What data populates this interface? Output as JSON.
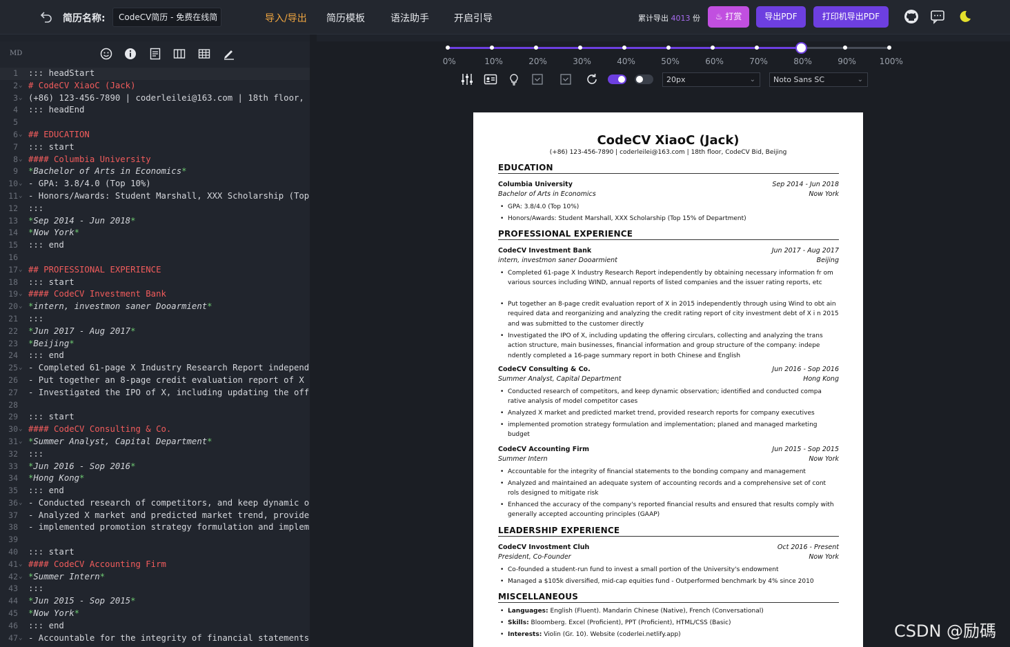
{
  "header": {
    "title_label": "简历名称:",
    "title_value": "CodeCV简历 - 免费在线简",
    "nav": [
      "导入/导出",
      "简历模板",
      "语法助手",
      "开启引导"
    ],
    "export_prefix": "累计导出",
    "export_count": "4013",
    "export_suffix": "份",
    "reward_label": "打赏",
    "export_pdf_label": "导出PDF",
    "print_pdf_label": "打印机导出PDF",
    "icons": [
      "back-icon",
      "github-icon",
      "message-icon",
      "moon-icon"
    ]
  },
  "editor": {
    "mode_label": "MD",
    "toolbar_icons": [
      "emoji-icon",
      "info-icon",
      "document-icon",
      "columns-icon",
      "table-icon",
      "pen-icon"
    ],
    "lines": [
      {
        "n": "1",
        "f": "",
        "t": "::: headStart",
        "k": ""
      },
      {
        "n": "2",
        "f": "⌄",
        "t": "# CodeCV XiaoC (Jack)",
        "k": "h"
      },
      {
        "n": "3",
        "f": "⌄",
        "t": "(+86) 123-456-7890 | coderleilei@163.com | 18th floor,",
        "k": ""
      },
      {
        "n": "4",
        "f": "",
        "t": "::: headEnd",
        "k": ""
      },
      {
        "n": "5",
        "f": "",
        "t": "",
        "k": ""
      },
      {
        "n": "6",
        "f": "⌄",
        "t": "## EDUCATION",
        "k": "h"
      },
      {
        "n": "7",
        "f": "",
        "t": "::: start",
        "k": ""
      },
      {
        "n": "8",
        "f": "⌄",
        "t": "#### Columbia University",
        "k": "h"
      },
      {
        "n": "9",
        "f": "",
        "t": "*Bachelor of Arts in Economics*",
        "k": "em"
      },
      {
        "n": "10",
        "f": "⌄",
        "t": "- GPA: 3.8/4.0 (Top 10%)",
        "k": ""
      },
      {
        "n": "11",
        "f": "⌄",
        "t": "- Honors/Awards: Student Marshall, XXX Scholarship (Top",
        "k": ""
      },
      {
        "n": "12",
        "f": "",
        "t": ":::",
        "k": ""
      },
      {
        "n": "13",
        "f": "",
        "t": "*Sep 2014 - Jun 2018*",
        "k": "em"
      },
      {
        "n": "14",
        "f": "",
        "t": "*Now York*",
        "k": "em"
      },
      {
        "n": "15",
        "f": "",
        "t": "::: end",
        "k": ""
      },
      {
        "n": "16",
        "f": "",
        "t": "",
        "k": ""
      },
      {
        "n": "17",
        "f": "⌄",
        "t": "## PROFESSIONAL EXPERIENCE",
        "k": "h"
      },
      {
        "n": "18",
        "f": "",
        "t": "::: start",
        "k": ""
      },
      {
        "n": "19",
        "f": "⌄",
        "t": "#### CodeCV Investment Bank",
        "k": "h"
      },
      {
        "n": "20",
        "f": "⌄",
        "t": "*intern, investmon saner Dooarmient*",
        "k": "em"
      },
      {
        "n": "21",
        "f": "",
        "t": ":::",
        "k": ""
      },
      {
        "n": "22",
        "f": "",
        "t": "*Jun 2017 - Aug 2017*",
        "k": "em"
      },
      {
        "n": "23",
        "f": "",
        "t": "*Beijing*",
        "k": "em"
      },
      {
        "n": "24",
        "f": "",
        "t": "::: end",
        "k": ""
      },
      {
        "n": "25",
        "f": "⌄",
        "t": "- Completed 61-page X Industry Research Report independ",
        "k": ""
      },
      {
        "n": "26",
        "f": "",
        "t": "- Put together an 8-page credit evaluation report of X",
        "k": ""
      },
      {
        "n": "27",
        "f": "",
        "t": "- Investigated the IPO of X, including updating the off",
        "k": ""
      },
      {
        "n": "28",
        "f": "",
        "t": "",
        "k": ""
      },
      {
        "n": "29",
        "f": "",
        "t": "::: start",
        "k": ""
      },
      {
        "n": "30",
        "f": "⌄",
        "t": "#### CodeCV Consulting & Co.",
        "k": "h"
      },
      {
        "n": "31",
        "f": "⌄",
        "t": "*Summer Analyst, Capital Department*",
        "k": "em"
      },
      {
        "n": "32",
        "f": "",
        "t": ":::",
        "k": ""
      },
      {
        "n": "33",
        "f": "",
        "t": "*Jun 2016 - Sop 2016*",
        "k": "em"
      },
      {
        "n": "34",
        "f": "",
        "t": "*Hong Kong*",
        "k": "em"
      },
      {
        "n": "35",
        "f": "",
        "t": "::: end",
        "k": ""
      },
      {
        "n": "36",
        "f": "⌄",
        "t": "- Conducted research of competitors, and keep dynamic o",
        "k": ""
      },
      {
        "n": "37",
        "f": "",
        "t": "- Analyzed X market and predicted market trend, provide",
        "k": ""
      },
      {
        "n": "38",
        "f": "",
        "t": "- implemented promotion strategy formulation and implem",
        "k": ""
      },
      {
        "n": "39",
        "f": "",
        "t": "",
        "k": ""
      },
      {
        "n": "40",
        "f": "",
        "t": "::: start",
        "k": ""
      },
      {
        "n": "41",
        "f": "⌄",
        "t": "#### CodeCV Accounting Firm",
        "k": "h"
      },
      {
        "n": "42",
        "f": "⌄",
        "t": "*Summer Intern*",
        "k": "em"
      },
      {
        "n": "43",
        "f": "",
        "t": ":::",
        "k": ""
      },
      {
        "n": "44",
        "f": "",
        "t": "*Jun 2015 - Sop 2015*",
        "k": "em"
      },
      {
        "n": "45",
        "f": "",
        "t": "*Now York*",
        "k": "em"
      },
      {
        "n": "46",
        "f": "",
        "t": "::: end",
        "k": ""
      },
      {
        "n": "47",
        "f": "⌄",
        "t": "- Accountable for the integrity of financial statements",
        "k": ""
      }
    ]
  },
  "preview": {
    "zoom_value": 0.8,
    "zoom_labels": [
      "0%",
      "10%",
      "20%",
      "30%",
      "40%",
      "50%",
      "60%",
      "70%",
      "80%",
      "90%",
      "100%"
    ],
    "control_icons": [
      "adjust-icon",
      "id-card-icon",
      "bulb-icon",
      "checkbox-icon",
      "checkbox-icon",
      "refresh-icon"
    ],
    "font_size": "20px",
    "font_family": "Noto Sans SC",
    "toggle_on_color": "#6d3fe0",
    "toggle_off_color": "#3a3f49"
  },
  "resume": {
    "name": "CodeCV XiaoC (Jack)",
    "contact": "(+86) 123-456-7890 | coderleilei@163.com | 18th floor, CodeCV Bid, Beijing",
    "sections": {
      "education": "EDUCATION",
      "professional": "PROFESSIONAL EXPERIENCE",
      "leadership": "LEADERSHIP EXPERIENCE",
      "misc": "MISCELLANEOUS"
    },
    "edu": {
      "school": "Columbia University",
      "date": "Sep 2014 - Jun 2018",
      "degree": "Bachelor of Arts in Economics",
      "location": "Now York",
      "bullets": [
        "GPA: 3.8/4.0 (Top 10%)",
        "Honors/Awards: Student Marshall, XXX Scholarship (Top 15% of Department)"
      ]
    },
    "jobs": [
      {
        "org": "CodeCV Investment Bank",
        "date": "Jun 2017 - Aug 2017",
        "role": "intern, investmon saner Dooarmient",
        "location": "Beijing",
        "bullets": [
          "Completed 61-page X Industry Research Report independently by obtaining necessary information fr om various sources including WIND, annual reports of listed companies and the issuer rating reports, etc",
          "Put together an 8-page credit evaluation report of X in 2015 independently through using Wind to obt ain required data and reorganizing and analyzing the credit rating report of city investment debt of X i n 2015 and was submitted to the customer directly",
          "Investigated the IPO of X, including updating the offering circulars, collecting and analyzing the trans action structure, main businesses, financial information and group structure of the company: indepe ndently completed a 16-page summary report in both Chinese and English"
        ]
      },
      {
        "org": "CodeCV Consulting & Co.",
        "date": "Jun 2016 - Sop 2016",
        "role": "Summer Analyst, Capital Department",
        "location": "Hong Kong",
        "bullets": [
          "Conducted research of competitors, and keep dynamic observation; identified and conducted compa rative analysis of model competitor cases",
          "Analyzed X market and predicted market trend, provided research reports for company executives",
          "implemented promotion strategy formulation and implementation; planed and managed marketing budget"
        ]
      },
      {
        "org": "CodeCV Accounting Firm",
        "date": "Jun 2015 - Sop 2015",
        "role": "Summer Intern",
        "location": "Now York",
        "bullets": [
          "Accountable for the integrity of financial statements to the bonding company and management",
          "Analyzed and maintained an adequate system of accounting records and a comprehensive set of cont rols designed to mitigate risk",
          "Enhanced the accuracy of the company's reported financial results and ensured that results comply with generally accepted accounting principles (GAAP)"
        ]
      }
    ],
    "leadership": {
      "org": "CodeCV Invostment Cluh",
      "date": "Oct 2016 - Present",
      "role": "President, Co-Founder",
      "location": "Now York",
      "bullets": [
        "Co-founded a student-run fund to invest a small portion of the University's endowment",
        "Managed a $105k diversified, mid-cap equities fund - Outperformed benchmark by 4% since 2010"
      ]
    },
    "misc": [
      {
        "k": "Languages:",
        "v": " English (Fluent). Mandarin Chinese (Native), French (Conversational)"
      },
      {
        "k": "Skills:",
        "v": " Bloomberg. Excel (Proficient), PPT (Proficient), HTML/CSS (Basic)"
      },
      {
        "k": "Interests:",
        "v": " Violin (Gr. 10). Website (coderlei.netlify.app)"
      }
    ]
  },
  "watermark": "CSDN @励碼"
}
